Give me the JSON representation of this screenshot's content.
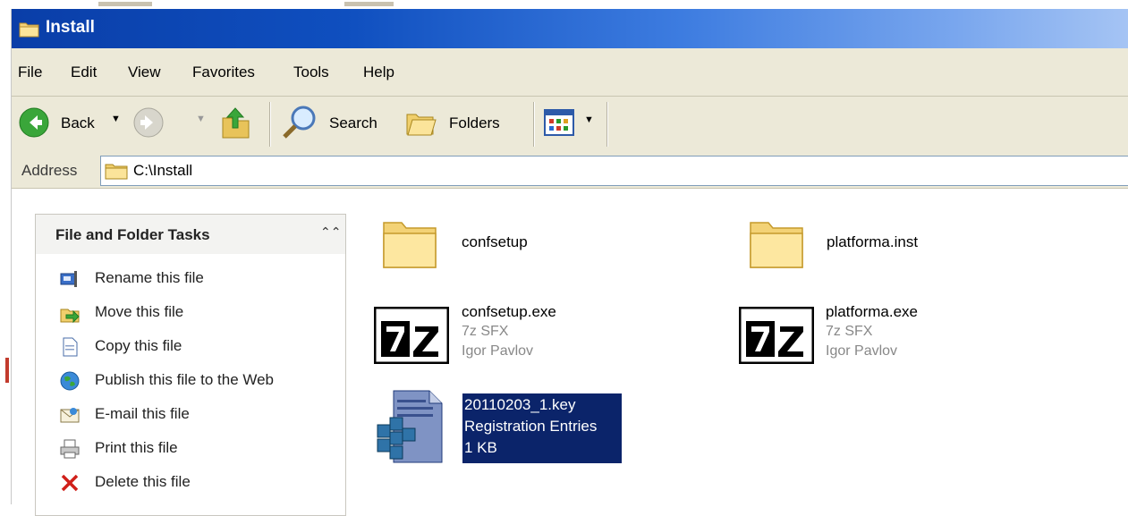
{
  "window": {
    "title": "Install"
  },
  "menu": [
    "File",
    "Edit",
    "View",
    "Favorites",
    "Tools",
    "Help"
  ],
  "toolbar": {
    "back_label": "Back",
    "search_label": "Search",
    "folders_label": "Folders"
  },
  "address": {
    "label": "Address",
    "value": "C:\\Install"
  },
  "tasks": {
    "title": "File and Folder Tasks",
    "items": [
      {
        "label": "Rename this file",
        "icon": "rename-icon"
      },
      {
        "label": "Move this file",
        "icon": "move-icon"
      },
      {
        "label": "Copy this file",
        "icon": "copy-icon"
      },
      {
        "label": "Publish this file to the Web",
        "icon": "globe-icon"
      },
      {
        "label": "E-mail this file",
        "icon": "email-icon"
      },
      {
        "label": "Print this file",
        "icon": "printer-icon"
      },
      {
        "label": "Delete this file",
        "icon": "delete-icon"
      }
    ]
  },
  "files": [
    {
      "name": "confsetup",
      "type": "folder"
    },
    {
      "name": "platforma.inst",
      "type": "folder"
    },
    {
      "name": "confsetup.exe",
      "line2": "7z SFX",
      "line3": "Igor Pavlov",
      "type": "7z"
    },
    {
      "name": "platforma.exe",
      "line2": "7z SFX",
      "line3": "Igor Pavlov",
      "type": "7z"
    },
    {
      "name": "20110203_1.key",
      "line2": "Registration Entries",
      "line3": "1 KB",
      "type": "reg",
      "selected": true
    }
  ],
  "colors": {
    "titlebar_start": "#0a3ea8",
    "titlebar_end": "#a5c4f4",
    "chrome": "#ece9d8",
    "selection": "#0b246a"
  }
}
